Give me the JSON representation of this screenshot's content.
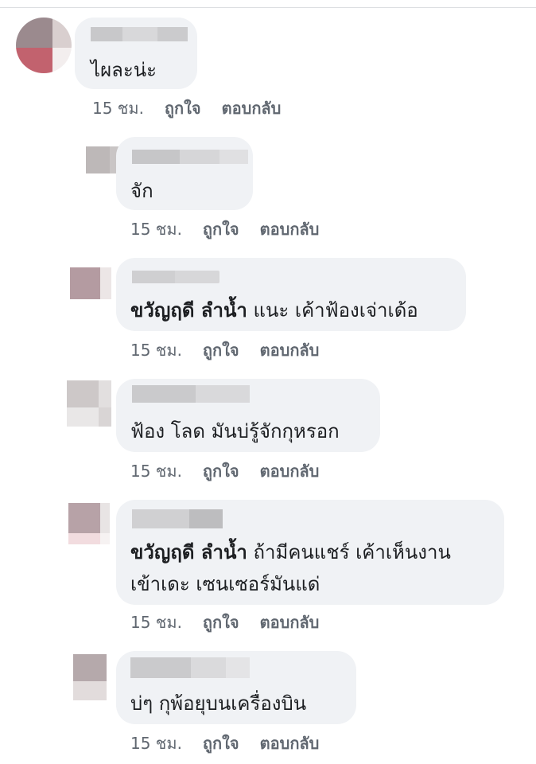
{
  "comments": [
    {
      "level": "top",
      "text": "ไผละน่ะ",
      "mention": "",
      "time": "15 ชม.",
      "like": "ถูกใจ",
      "reply": "ตอบกลับ"
    },
    {
      "level": "reply",
      "text": "จัก",
      "mention": "",
      "time": "15 ชม.",
      "like": "ถูกใจ",
      "reply": "ตอบกลับ"
    },
    {
      "level": "reply",
      "text": "แนะ เค้าฟ้องเจ่าเด้อ",
      "mention": "ขวัญฤดี ลำน้ำ",
      "time": "15 ชม.",
      "like": "ถูกใจ",
      "reply": "ตอบกลับ"
    },
    {
      "level": "reply",
      "text": "ฟ้อง โลด มันบ่รู้จักกุหรอก",
      "mention": "",
      "time": "15 ชม.",
      "like": "ถูกใจ",
      "reply": "ตอบกลับ"
    },
    {
      "level": "reply",
      "text": "ถ้ามีคนแชร์ เค้าเห็นงาน",
      "text_line2": "เข้าเดะ เซนเซอร์มันแด่",
      "mention": "ขวัญฤดี ลำน้ำ",
      "time": "15 ชม.",
      "like": "ถูกใจ",
      "reply": "ตอบกลับ"
    },
    {
      "level": "reply",
      "text": "บ่ๆ กุพ้อยุบนเครื่องบิน",
      "mention": "",
      "time": "15 ชม.",
      "like": "ถูกใจ",
      "reply": "ตอบกลับ"
    }
  ],
  "colors": {
    "bubble": "#f0f2f5",
    "meta": "#606770",
    "text": "#1c1e21"
  }
}
